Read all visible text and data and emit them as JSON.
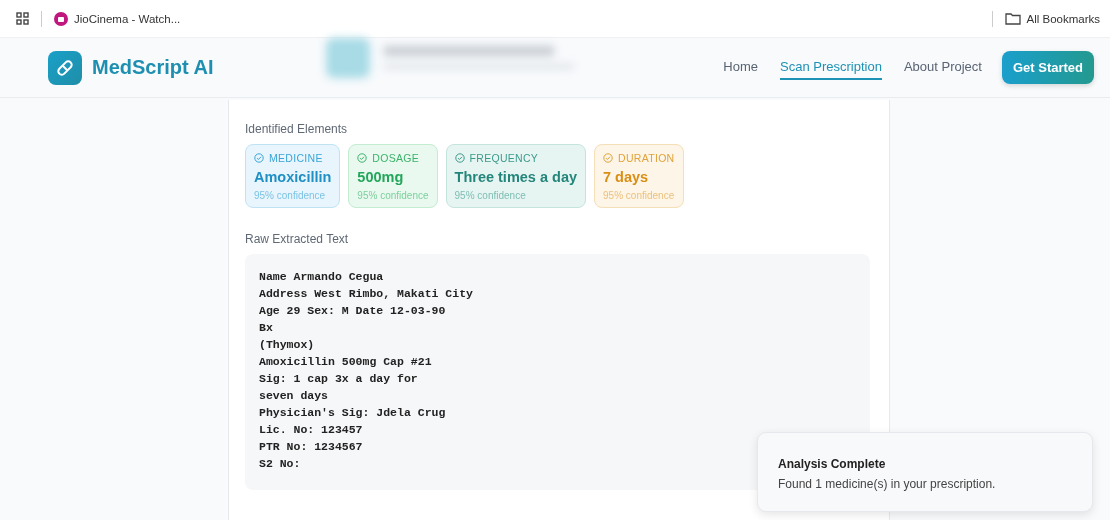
{
  "bookmarks_bar": {
    "items": [
      {
        "label": "JioCinema - Watch..."
      }
    ],
    "all_bookmarks": "All Bookmarks"
  },
  "header": {
    "logo": "MedScript AI",
    "nav": [
      {
        "label": "Home",
        "selected": false
      },
      {
        "label": "Scan Prescription",
        "selected": true
      },
      {
        "label": "About Project",
        "selected": false
      }
    ],
    "cta": "Get Started"
  },
  "identified": {
    "heading": "Identified Elements",
    "elements": [
      {
        "kind": "medicine",
        "label": "MEDICINE",
        "value": "Amoxicillin",
        "confidence": "95% confidence"
      },
      {
        "kind": "dosage",
        "label": "DOSAGE",
        "value": "500mg",
        "confidence": "95% confidence"
      },
      {
        "kind": "frequency",
        "label": "FREQUENCY",
        "value": "Three times a day",
        "confidence": "95% confidence"
      },
      {
        "kind": "duration",
        "label": "DURATION",
        "value": "7 days",
        "confidence": "95% confidence"
      }
    ]
  },
  "raw_text": {
    "heading": "Raw Extracted Text",
    "lines": [
      "Name Armando Cegua",
      "Address West Rimbo, Makati City",
      "Age 29 Sex: M Date 12-03-90",
      "Bx",
      "(Thymox)",
      "Amoxicillin 500mg Cap #21",
      "Sig: 1 cap 3x a day for",
      "seven days",
      "Physician's Sig: Jdela Crug",
      "Lic. No: 123457",
      "PTR No: 1234567",
      "S2 No:"
    ]
  },
  "toast": {
    "title": "Analysis Complete",
    "message": "Found 1 medicine(s) in your prescription."
  }
}
